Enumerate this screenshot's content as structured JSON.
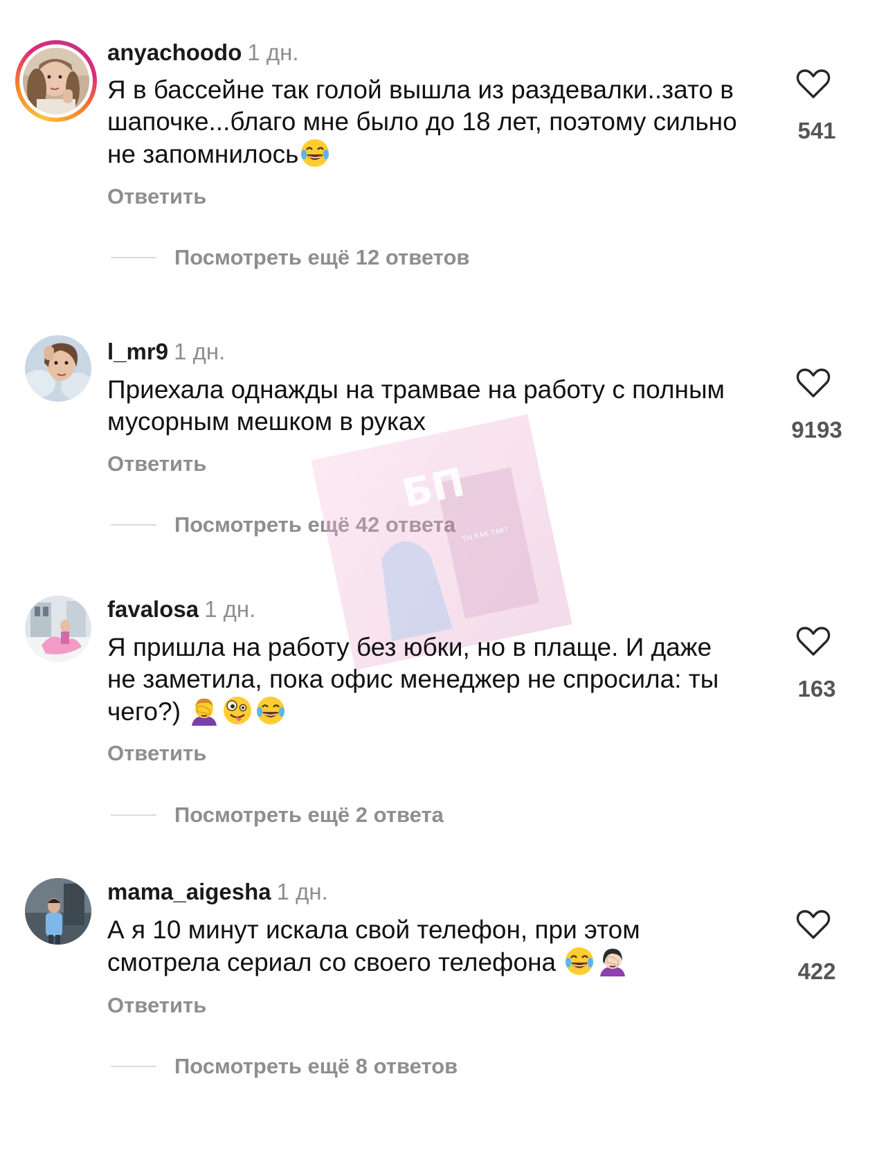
{
  "comments": [
    {
      "username": "anyachoodo",
      "time": "1 дн.",
      "text": "Я в бассейне так голой вышла из раздевалки..зато в шапочке...благо мне было до 18 лет, поэтому сильно не запомнилось",
      "emojis": [
        "face-with-tears-of-joy"
      ],
      "likes": "541",
      "reply_label": "Ответить",
      "more_replies": "Посмотреть ещё 12 ответов",
      "has_story": true
    },
    {
      "username": "l_mr9",
      "time": "1 дн.",
      "text": "Приехала однажды на трамвае на работу с полным мусорным мешком в руках",
      "emojis": [],
      "likes": "9193",
      "reply_label": "Ответить",
      "more_replies": "Посмотреть ещё 42 ответа",
      "has_story": false
    },
    {
      "username": "favalosa",
      "time": "1 дн.",
      "text": "Я пришла на работу без юбки, но в плаще. И даже не заметила, пока  офис менеджер не спросила: ты чего?)",
      "emojis": [
        "person-facepalming",
        "zany-face",
        "face-with-tears-of-joy"
      ],
      "likes": "163",
      "reply_label": "Ответить",
      "more_replies": "Посмотреть ещё 2 ответа",
      "has_story": false
    },
    {
      "username": "mama_aigesha",
      "time": "1 дн.",
      "text": "А я 10 минут искала свой телефон, при этом смотрела сериал со своего  телефона",
      "emojis": [
        "face-with-tears-of-joy",
        "person-facepalming"
      ],
      "likes": "422",
      "reply_label": "Ответить",
      "more_replies": "Посмотреть ещё 8 ответов",
      "has_story": false
    }
  ],
  "icons": {
    "like": "heart-outline-icon"
  },
  "colors": {
    "secondary_text": "#8e8e8e",
    "primary_text": "#111111",
    "divider": "#dbdbdb",
    "story_ring": [
      "#f9c33d",
      "#f58529",
      "#dd2a7b",
      "#c13584"
    ]
  },
  "watermark": {
    "logo_text": "БП",
    "sign_text": "ТЫ КАК ТАК?"
  }
}
